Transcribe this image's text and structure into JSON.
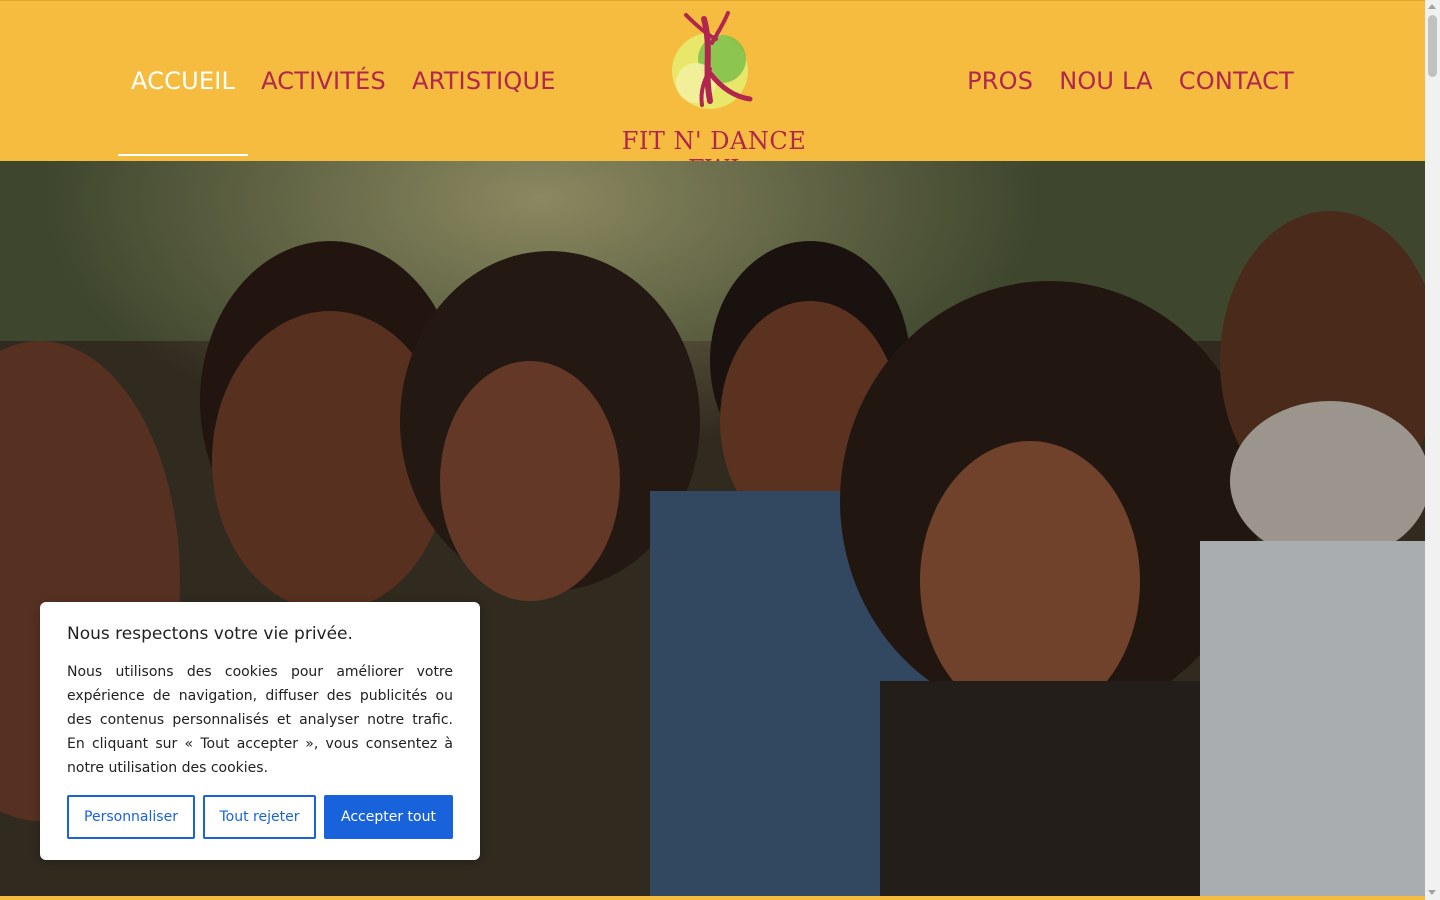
{
  "header": {
    "nav_left": [
      "ACCUEIL",
      "ACTIVITÉS",
      "ARTISTIQUE"
    ],
    "nav_right": [
      "PROS",
      "NOU LA",
      "CONTACT"
    ],
    "logo_text": "FIT N' DANCE FWI",
    "colors": {
      "background": "#f5bc3f",
      "nav_text": "#b0264e",
      "active_text": "#ffffff"
    }
  },
  "hero": {
    "image": "family-smiling-photo"
  },
  "cookie": {
    "title": "Nous respectons votre vie privée.",
    "text": "Nous utilisons des cookies pour améliorer votre expérience de navigation, diffuser des publicités ou des contenus personnalisés et analyser notre trafic. En cliquant sur « Tout accepter », vous consentez à notre utilisation des cookies.",
    "buttons": {
      "customize": "Personnaliser",
      "reject": "Tout rejeter",
      "accept": "Accepter tout"
    },
    "accent": "#1863dc"
  }
}
